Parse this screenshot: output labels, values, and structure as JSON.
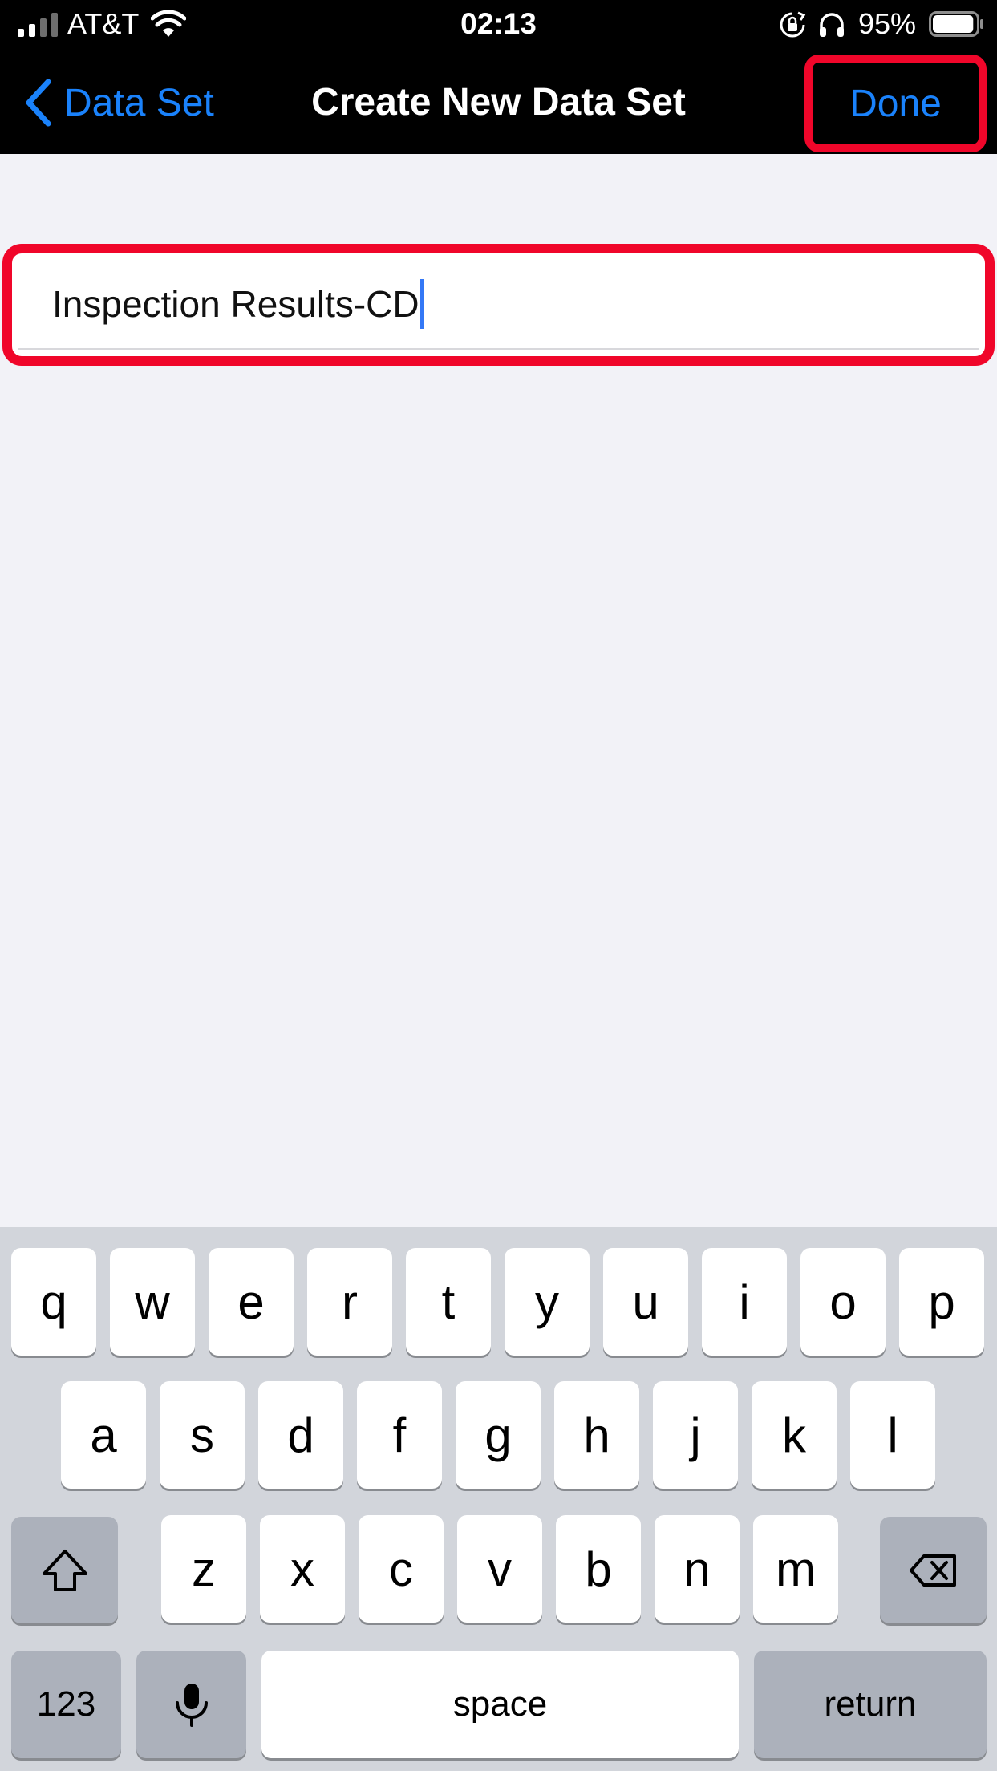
{
  "status_bar": {
    "carrier": "AT&T",
    "time": "02:13",
    "battery_percent": "95%",
    "battery_level": 0.95,
    "icons": [
      "signal-bars-icon",
      "wifi-icon",
      "rotation-lock-icon",
      "headphones-icon",
      "battery-icon"
    ]
  },
  "nav": {
    "back_label": "Data Set",
    "title": "Create New Data Set",
    "done_label": "Done",
    "accent": "#1a82fb",
    "highlight": "#f0062a"
  },
  "form": {
    "name_value": "Inspection Results-CD"
  },
  "keyboard": {
    "row1": [
      "q",
      "w",
      "e",
      "r",
      "t",
      "y",
      "u",
      "i",
      "o",
      "p"
    ],
    "row2": [
      "a",
      "s",
      "d",
      "f",
      "g",
      "h",
      "j",
      "k",
      "l"
    ],
    "row3": [
      "z",
      "x",
      "c",
      "v",
      "b",
      "n",
      "m"
    ],
    "numbers_label": "123",
    "space_label": "space",
    "return_label": "return"
  }
}
